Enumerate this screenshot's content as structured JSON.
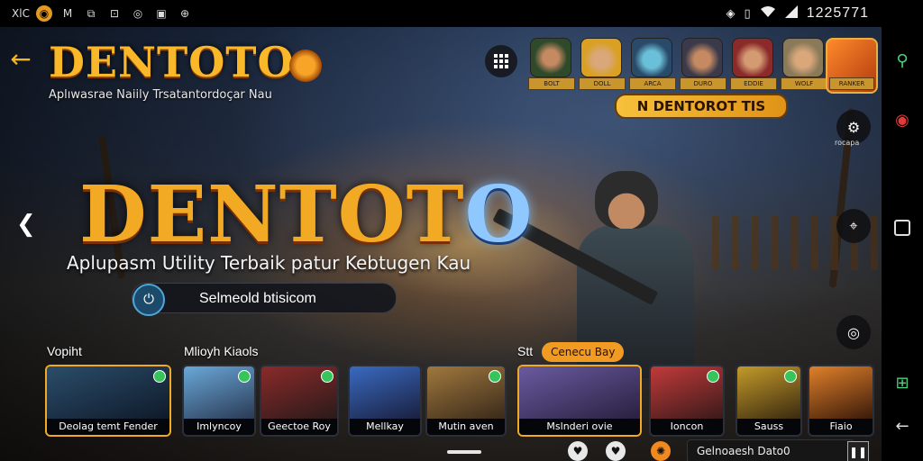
{
  "status_bar": {
    "left_icons": [
      "xlc-icon",
      "coin-icon",
      "mail-icon",
      "shield-icon",
      "image-icon",
      "circle-icon",
      "photo-icon",
      "globe-icon"
    ],
    "left_labels": [
      "XlC",
      "◉",
      "M",
      "⧉",
      "⊡",
      "◎",
      "▣",
      "⊕"
    ],
    "right_icons": [
      "location-icon",
      "vibrate-icon",
      "wifi-icon",
      "signal-icon"
    ],
    "time": "1225771"
  },
  "header": {
    "logo_text": "DENTOTO",
    "tagline": "Aplıwasrae Naiily Trsatantordoçar Nau",
    "banner": "N DENTOROT TIS"
  },
  "avatars": [
    {
      "label": "BOLT"
    },
    {
      "label": "DOLL"
    },
    {
      "label": "ARCA"
    },
    {
      "label": "DURO"
    },
    {
      "label": "EDDIE"
    },
    {
      "label": "WOLF"
    },
    {
      "label": "RANKER"
    }
  ],
  "right_controls": {
    "top_label": "rocapa"
  },
  "hero": {
    "logo_text_gold": "DENTOT",
    "logo_text_blue": "O",
    "subtitle": "Aplupasm Utility Terbaik patur Kebtugen Kau",
    "search_value": "Selmeold btisicom"
  },
  "sections": {
    "left_label": "Vopiht",
    "mid_label": "Mlioyh Kiaols",
    "right_label": "Stt",
    "pill_label": "Cenecu Bay"
  },
  "cards": [
    {
      "label": "Deolag temt Fender",
      "colors": [
        "#2b4d6a",
        "#0f1a2a"
      ]
    },
    {
      "label": "Imlyncoy",
      "colors": [
        "#6aa8d8",
        "#2a3a55"
      ]
    },
    {
      "label": "Geectoe Roy",
      "colors": [
        "#8b2a2a",
        "#2a1a1a"
      ]
    },
    {
      "label": "Mellkay",
      "colors": [
        "#3a6ac0",
        "#1a2040"
      ]
    },
    {
      "label": "Mutin aven",
      "colors": [
        "#a0783e",
        "#3a2a1a"
      ]
    },
    {
      "label": "Mslnderi ovie",
      "colors": [
        "#6a5aa0",
        "#2a2040"
      ]
    },
    {
      "label": "Ioncon",
      "colors": [
        "#c23a3a",
        "#3a1a1a"
      ]
    },
    {
      "label": "Sauss",
      "colors": [
        "#c49a2a",
        "#3a2a10"
      ]
    },
    {
      "label": "Fiaio",
      "colors": [
        "#e0802a",
        "#3a1a0a"
      ]
    }
  ],
  "bottom": {
    "field_text": "Gelnoaesh Dato0"
  },
  "colors": {
    "accent": "#f2a923",
    "brand_blue": "#8fc7ff"
  }
}
